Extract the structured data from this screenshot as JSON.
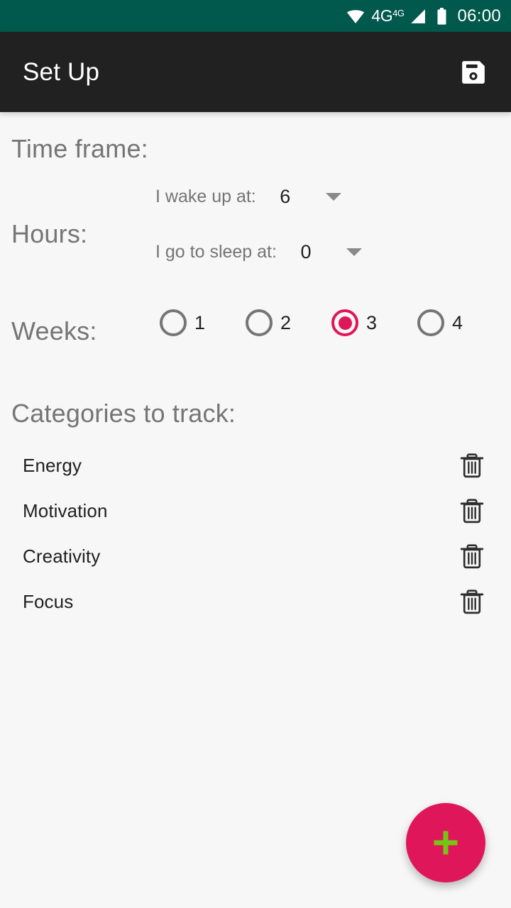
{
  "status_bar": {
    "wifi_icon": "wifi-icon",
    "network_label": "4G",
    "network_sup": "4G",
    "signal_icon": "signal-icon",
    "battery_icon": "battery-icon",
    "time": "06:00",
    "background_color": "#00594C"
  },
  "toolbar": {
    "title": "Set Up",
    "save_icon": "save-floppy-icon",
    "background_color": "#212121"
  },
  "sections": {
    "timeframe_heading": "Time frame:",
    "hours_heading": "Hours:",
    "weeks_heading": "Weeks:",
    "categories_heading": "Categories to track:"
  },
  "hours": {
    "wake": {
      "label": "I wake up at:",
      "value": "6",
      "caret_icon": "chevron-down-icon"
    },
    "sleep": {
      "label": "I go to sleep at:",
      "value": "0",
      "caret_icon": "chevron-down-icon"
    }
  },
  "weeks": {
    "options": [
      {
        "label": "1",
        "selected": false
      },
      {
        "label": "2",
        "selected": false
      },
      {
        "label": "3",
        "selected": true
      },
      {
        "label": "4",
        "selected": false
      }
    ],
    "selected_value": "3",
    "accent_color": "#E0165B",
    "inactive_color": "#757575"
  },
  "categories": [
    {
      "name": "Energy",
      "delete_icon": "trash-icon"
    },
    {
      "name": "Motivation",
      "delete_icon": "trash-icon"
    },
    {
      "name": "Creativity",
      "delete_icon": "trash-icon"
    },
    {
      "name": "Focus",
      "delete_icon": "trash-icon"
    }
  ],
  "fab": {
    "icon": "plus-icon",
    "background_color": "#E0165B",
    "icon_color": "#7CC川"
  },
  "colors": {
    "page_background": "#F7F7F7",
    "heading_gray": "#757575",
    "body_dark": "#212121",
    "accent_pink": "#E0165B",
    "fab_plus_green": "#76C514",
    "status_teal": "#00594C"
  }
}
